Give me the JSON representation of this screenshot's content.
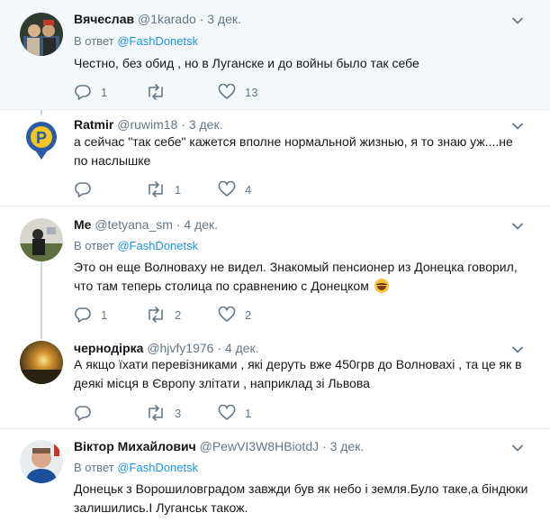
{
  "tweets": [
    {
      "name": "Вячеслав",
      "handle": "@1karado",
      "time": "3 дек.",
      "reply_prefix": "В ответ",
      "reply_to": "@FashDonetsk",
      "text": "Честно, без обид , но в Луганске и до войны было так себе",
      "replies": "1",
      "retweets": "",
      "likes": "13"
    },
    {
      "name": "Ratmir",
      "handle": "@ruwim18",
      "time": "3 дек.",
      "reply_prefix": "",
      "reply_to": "",
      "text": "а сейчас \"так себе\" кажется вполне нормальной жизнью, я то знаю уж....не по наслышке",
      "replies": "",
      "retweets": "1",
      "likes": "4"
    },
    {
      "name": "Me",
      "handle": "@tetyana_sm",
      "time": "4 дек.",
      "reply_prefix": "В ответ",
      "reply_to": "@FashDonetsk",
      "text": "Это он еще Волноваху не видел. Знакомый пенсионер из Донецка говорил, что там теперь столица по сравнению с Донецком",
      "replies": "1",
      "retweets": "2",
      "likes": "2"
    },
    {
      "name": "чернодірка",
      "handle": "@hjvfy1976",
      "time": "4 дек.",
      "reply_prefix": "",
      "reply_to": "",
      "text": "А якщо їхати перевізниками , які деруть вже 450грв до Волновахі , та це як в деякі місця в Європу злітати , наприклад зі Львова",
      "replies": "",
      "retweets": "3",
      "likes": "1"
    },
    {
      "name": "Віктор Михайлович",
      "handle": "@PewVI3W8HBiotdJ",
      "time": "3 дек.",
      "reply_prefix": "В ответ",
      "reply_to": "@FashDonetsk",
      "text": "Донецьк з Ворошиловградом завжди був як небо і земля.Було таке,а біндюки залишились.І Луганськ також."
    }
  ],
  "separator": "·",
  "icons": {
    "reply": "reply-icon",
    "retweet": "retweet-icon",
    "like": "heart-icon",
    "menu": "chevron-down-icon"
  },
  "colors": {
    "link": "#1b95e0",
    "secondary": "#657786",
    "highlight_bg": "#f5f8fa",
    "thread_line": "#ccd6dd"
  }
}
